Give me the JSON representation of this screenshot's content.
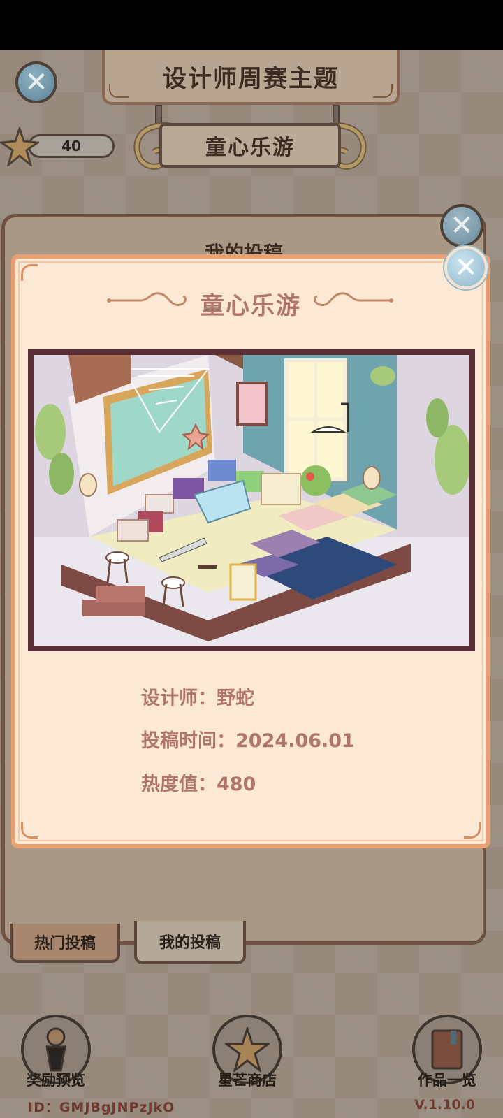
{
  "header": {
    "title": "设计师周赛主题",
    "theme_name": "童心乐游",
    "star_count": "40"
  },
  "back_panel": {
    "title": "我的投稿"
  },
  "card": {
    "title": "童心乐游",
    "designer_label": "设计师：",
    "designer_value": "野蛇",
    "submit_time_label": "投稿时间：",
    "submit_time_value": "2024.06.01",
    "heat_label": "热度值：",
    "heat_value": "480"
  },
  "tabs": [
    {
      "label": "热门投稿",
      "active": false
    },
    {
      "label": "我的投稿",
      "active": true
    }
  ],
  "bottom_nav": [
    {
      "label": "奖励预览",
      "icon": "trophy-icon"
    },
    {
      "label": "星芒商店",
      "icon": "star-icon"
    },
    {
      "label": "作品一览",
      "icon": "book-icon"
    }
  ],
  "footer": {
    "id_text": "ID：GMJBgJNPzJkO",
    "version": "V.1.10.0"
  },
  "colors": {
    "card_bg": "#fbe9d6",
    "card_border": "#e9a070",
    "accent_text": "#b0766e",
    "frame": "#5b2f36"
  }
}
